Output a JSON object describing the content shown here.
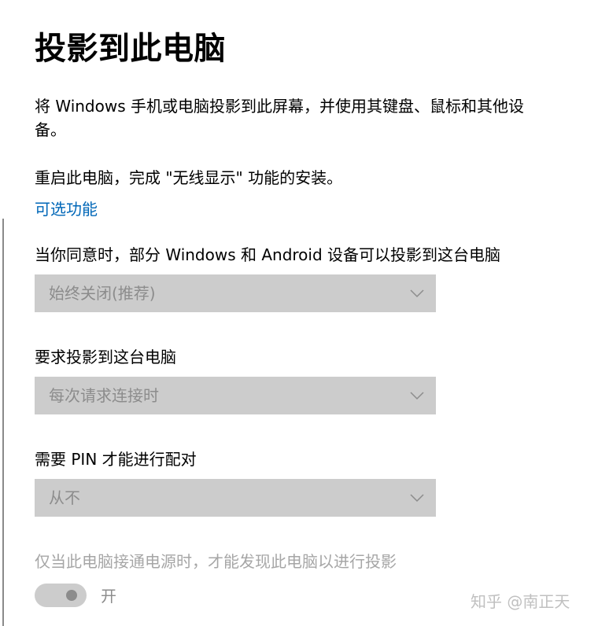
{
  "page": {
    "title": "投影到此电脑",
    "description": "将 Windows 手机或电脑投影到此屏幕，并使用其键盘、鼠标和其他设备。",
    "restart_notice": "重启此电脑，完成 \"无线显示\" 功能的安装。",
    "optional_features_link": "可选功能"
  },
  "settings": {
    "availability": {
      "label": "当你同意时，部分 Windows 和 Android 设备可以投影到这台电脑",
      "value": "始终关闭(推荐)"
    },
    "ask_to_project": {
      "label": "要求投影到这台电脑",
      "value": "每次请求连接时"
    },
    "require_pin": {
      "label": "需要 PIN 才能进行配对",
      "value": "从不"
    },
    "power_only": {
      "label": "仅当此电脑接通电源时，才能发现此电脑以进行投影",
      "toggle_state": "开"
    }
  },
  "watermark": "知乎 @南正天",
  "colors": {
    "link": "#0067b8",
    "dropdown_bg": "#cccccc",
    "disabled_text": "#8c8c8c"
  }
}
